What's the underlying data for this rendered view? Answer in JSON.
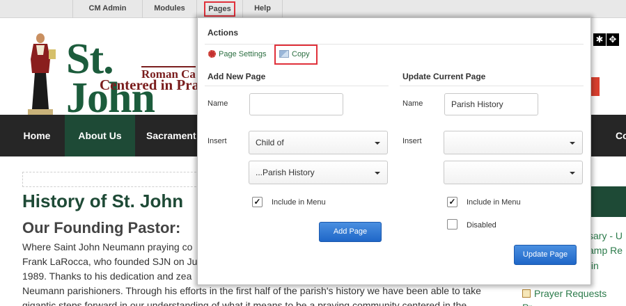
{
  "admin_bar": {
    "items": [
      "CM Admin",
      "Modules",
      "Pages",
      "Help"
    ]
  },
  "header": {
    "logo_main": "St. John",
    "logo_sub1": "Roman Ca",
    "logo_sub2": "Centered in Pra",
    "icons": [
      "gear-icon",
      "move-icon"
    ]
  },
  "nav": {
    "items": [
      "Home",
      "About Us",
      "Sacrament",
      "Co"
    ],
    "active_color": "#1e4a36"
  },
  "content": {
    "h1": "History of St. John",
    "h2": "Our Founding Pastor:",
    "lines": [
      "Where Saint John Neumann praying co",
      "Frank LaRocca, who founded SJN on Ju",
      "1989. Thanks to his dedication and zea",
      "Neumann parishioners. Through his efforts in the first half of the parish's history we have been able to take",
      "gigantic steps forward in our understanding of what it means to be a praying community centered in the"
    ]
  },
  "sidebar": {
    "links": [
      "sary - U",
      "amp Re",
      "tin"
    ],
    "prayer_requests": "Prayer Requests",
    "prayer2": "Pr"
  },
  "panel": {
    "actions_title": "Actions",
    "page_settings": "Page Settings",
    "copy": "Copy",
    "add": {
      "title": "Add New Page",
      "name_label": "Name",
      "name_value": "",
      "insert_label": "Insert",
      "insert_value": "Child of",
      "parent_value": "...Parish History",
      "include_label": "Include in Menu",
      "include_checked": true,
      "button": "Add Page"
    },
    "update": {
      "title": "Update Current Page",
      "name_label": "Name",
      "name_value": "Parish History",
      "insert_label": "Insert",
      "insert_value": "",
      "parent_value": "",
      "include_label": "Include in Menu",
      "include_checked": true,
      "disabled_label": "Disabled",
      "disabled_checked": false,
      "button": "Update Page"
    }
  }
}
